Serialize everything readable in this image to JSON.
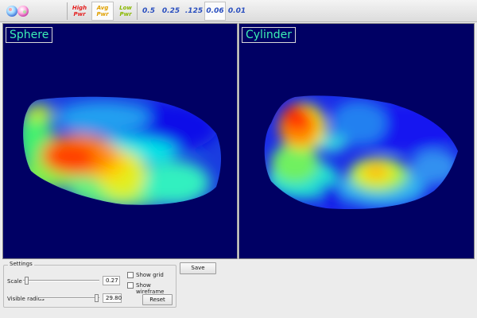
{
  "toolbar": {
    "power_buttons": [
      {
        "line1": "High",
        "line2": "Pwr",
        "color": "#e52020"
      },
      {
        "line1": "Avg",
        "line2": "Pwr",
        "color": "#e0a000"
      },
      {
        "line1": "Low",
        "line2": "Pwr",
        "color": "#8ab800"
      }
    ],
    "scale_buttons": [
      "0.5",
      "0.25",
      ".125",
      "0.06",
      "0.01"
    ],
    "selected_scale": "0.06"
  },
  "viewports": {
    "left_title": "Sphere",
    "right_title": "Cylinder",
    "background": "#000064",
    "title_color": "#3cf0b4"
  },
  "settings": {
    "legend": "Settings",
    "scale_label": "Scale",
    "scale_value": "0.27",
    "scale_fraction": 0.02,
    "radius_label": "Visible radius",
    "radius_value": "29.80",
    "radius_fraction": 0.98,
    "show_grid_label": "Show grid",
    "show_grid_checked": false,
    "show_wireframe_label": "Show wireframe",
    "show_wireframe_checked": false,
    "reset_label": "Reset",
    "save_label": "Save"
  }
}
